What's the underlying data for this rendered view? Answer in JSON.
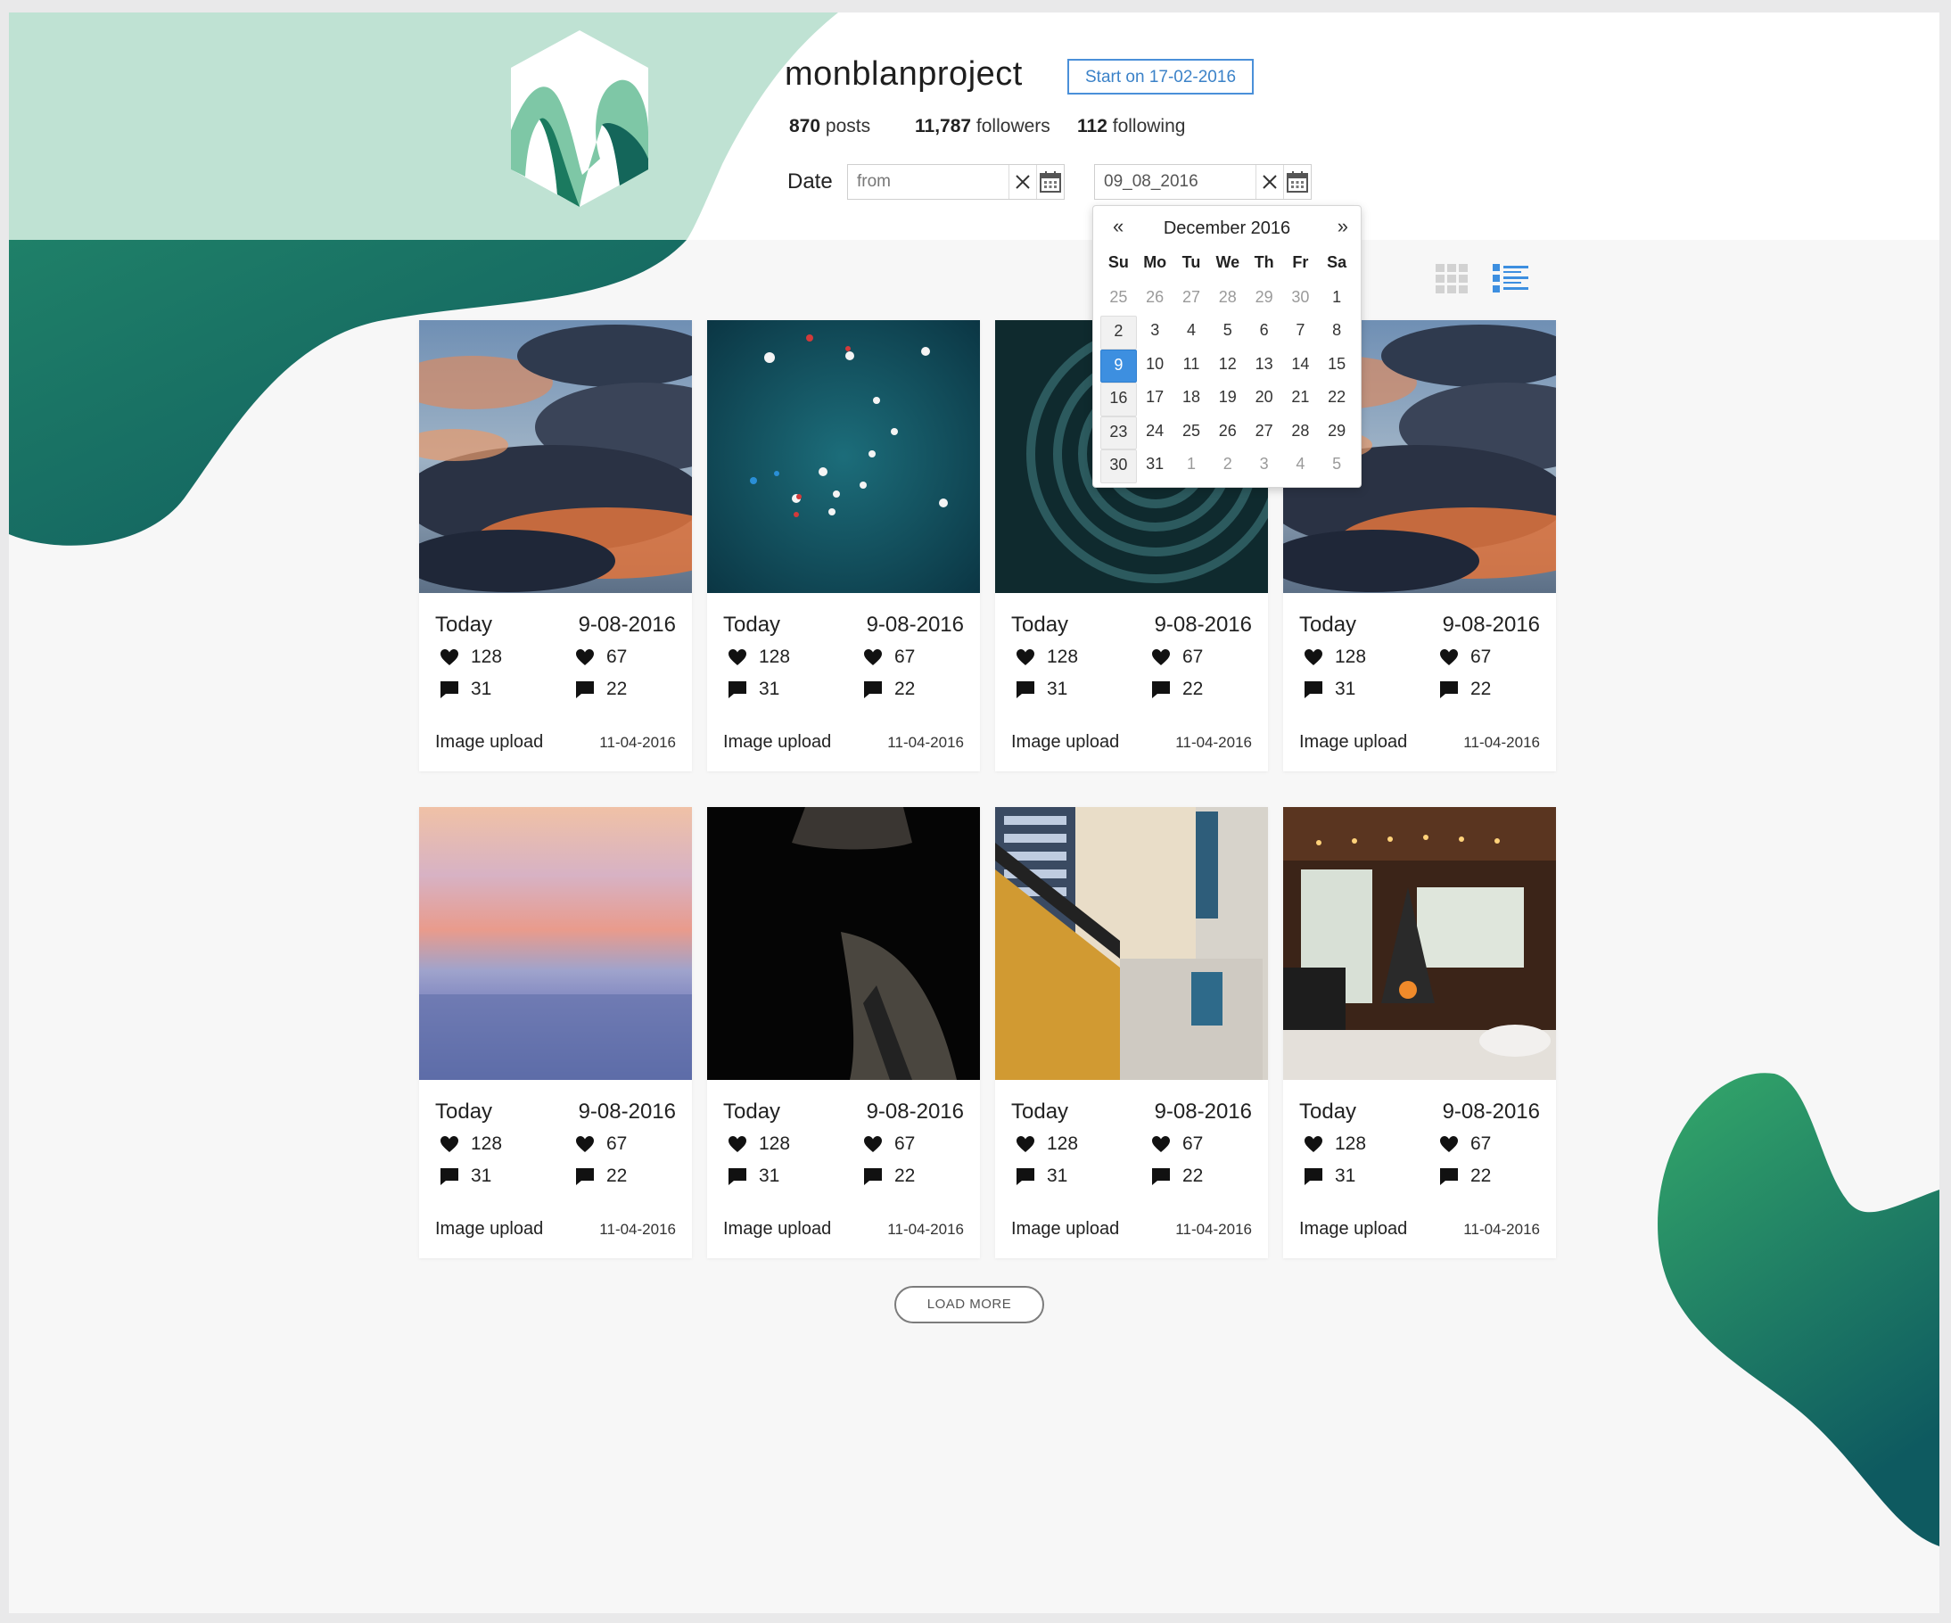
{
  "profile": {
    "username": "monblanproject",
    "start_badge": "Start on 17-02-2016",
    "posts_count": "870",
    "posts_label": "posts",
    "followers_count": "11,787",
    "followers_label": "followers",
    "following_count": "112",
    "following_label": "following"
  },
  "filter": {
    "date_label": "Date",
    "from_placeholder": "from",
    "to_value": "09_08_2016"
  },
  "calendar": {
    "prev": "«",
    "next": "»",
    "title": "December 2016",
    "weekdays": [
      "Su",
      "Mo",
      "Tu",
      "We",
      "Th",
      "Fr",
      "Sa"
    ],
    "weeks": [
      [
        "25",
        "26",
        "27",
        "28",
        "29",
        "30",
        "1"
      ],
      [
        "2",
        "3",
        "4",
        "5",
        "6",
        "7",
        "8"
      ],
      [
        "9",
        "10",
        "11",
        "12",
        "13",
        "14",
        "15"
      ],
      [
        "16",
        "17",
        "18",
        "19",
        "20",
        "21",
        "22"
      ],
      [
        "23",
        "24",
        "25",
        "26",
        "27",
        "28",
        "29"
      ],
      [
        "30",
        "31",
        "1",
        "2",
        "3",
        "4",
        "5"
      ]
    ],
    "selected": "9"
  },
  "posts": [
    {
      "image": "sunset-clouds",
      "today": "Today",
      "date": "9-08-2016",
      "likes": "128",
      "comments": "31",
      "likes2": "67",
      "comments2": "22",
      "upload_label": "Image upload",
      "upload_date": "11-04-2016"
    },
    {
      "image": "boats-aerial",
      "today": "Today",
      "date": "9-08-2016",
      "likes": "128",
      "comments": "31",
      "likes2": "67",
      "comments2": "22",
      "upload_label": "Image upload",
      "upload_date": "11-04-2016"
    },
    {
      "image": "spiral-building",
      "today": "Today",
      "date": "9-08-2016",
      "likes": "128",
      "comments": "31",
      "likes2": "67",
      "comments2": "22",
      "upload_label": "Image upload",
      "upload_date": "11-04-2016"
    },
    {
      "image": "sunset-clouds",
      "today": "Today",
      "date": "9-08-2016",
      "likes": "128",
      "comments": "31",
      "likes2": "67",
      "comments2": "22",
      "upload_label": "Image upload",
      "upload_date": "11-04-2016"
    },
    {
      "image": "pastel-sea",
      "today": "Today",
      "date": "9-08-2016",
      "likes": "128",
      "comments": "31",
      "likes2": "67",
      "comments2": "22",
      "upload_label": "Image upload",
      "upload_date": "11-04-2016"
    },
    {
      "image": "man-in-hat",
      "today": "Today",
      "date": "9-08-2016",
      "likes": "128",
      "comments": "31",
      "likes2": "67",
      "comments2": "22",
      "upload_label": "Image upload",
      "upload_date": "11-04-2016"
    },
    {
      "image": "yellow-wall-building",
      "today": "Today",
      "date": "9-08-2016",
      "likes": "128",
      "comments": "31",
      "likes2": "67",
      "comments2": "22",
      "upload_label": "Image upload",
      "upload_date": "11-04-2016"
    },
    {
      "image": "cabin-interior",
      "today": "Today",
      "date": "9-08-2016",
      "likes": "128",
      "comments": "31",
      "likes2": "67",
      "comments2": "22",
      "upload_label": "Image upload",
      "upload_date": "11-04-2016"
    }
  ],
  "load_more": "LOAD MORE",
  "icons": {
    "likes": "heart-icon",
    "comments": "comment-icon",
    "clear": "close-icon",
    "calendar": "calendar-icon",
    "grid_view": "grid-view-icon",
    "list_view": "list-view-icon"
  },
  "colors": {
    "brand_dark": "#0f5e60",
    "brand_mid": "#2e8f6e",
    "brand_light": "#bfe2d3",
    "accent_blue": "#3d8fe0"
  }
}
